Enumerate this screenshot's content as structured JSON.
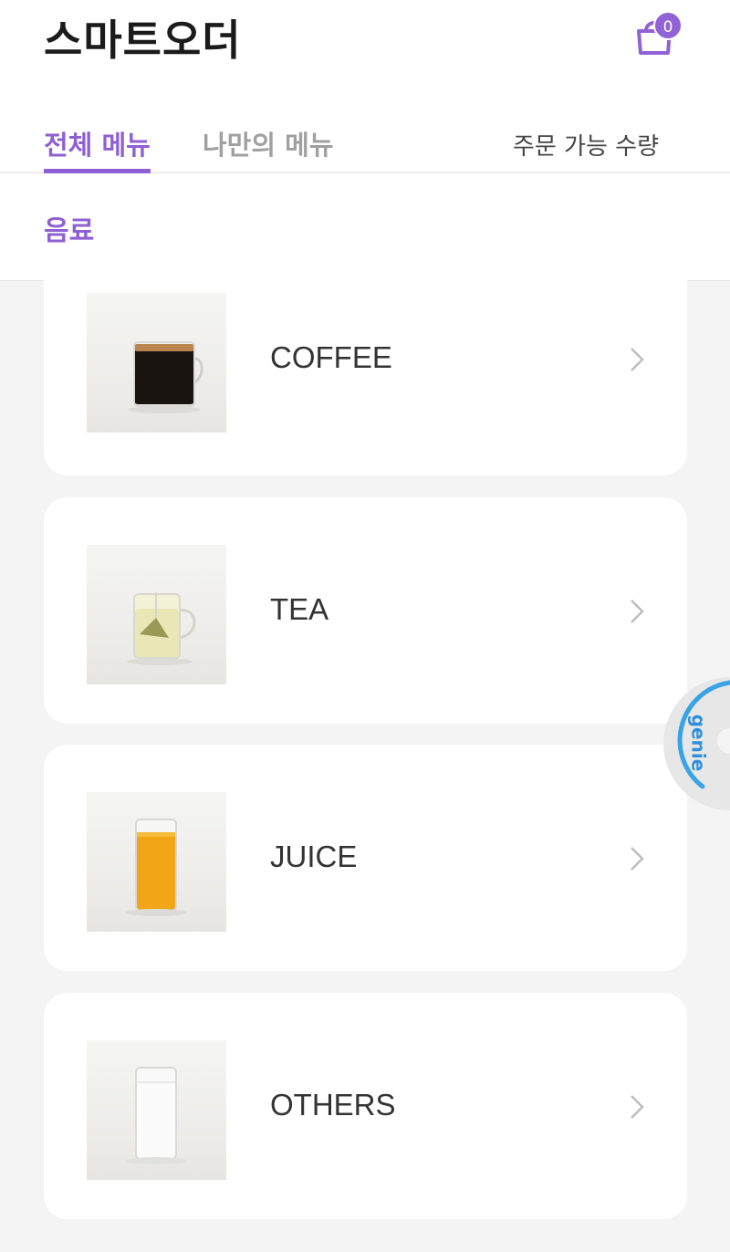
{
  "header": {
    "app_title": "스마트오더",
    "cart_count": "0"
  },
  "tabs": [
    {
      "label": "전체 메뉴",
      "active": true
    },
    {
      "label": "나만의 메뉴",
      "active": false
    }
  ],
  "order_quantity_label": "주문 가능 수량",
  "category": "음료",
  "menu_items": [
    {
      "label": "COFFEE",
      "icon": "coffee-mug-image"
    },
    {
      "label": "TEA",
      "icon": "tea-mug-image"
    },
    {
      "label": "JUICE",
      "icon": "juice-glass-image"
    },
    {
      "label": "OTHERS",
      "icon": "milk-glass-image"
    }
  ],
  "genie_label": "genie",
  "colors": {
    "accent": "#8f5fd4",
    "background": "#f4f4f4",
    "card": "#ffffff"
  }
}
